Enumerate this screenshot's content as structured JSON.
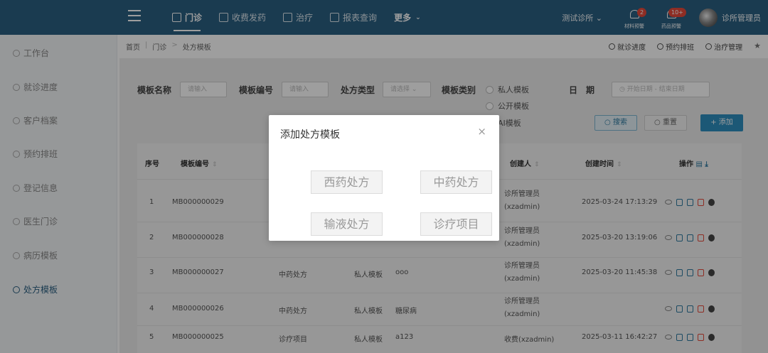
{
  "topbar": {
    "nav": [
      {
        "label": "门诊",
        "icon": "edit-icon",
        "active": true
      },
      {
        "label": "收费发药",
        "icon": "cash-icon",
        "active": false
      },
      {
        "label": "治疗",
        "icon": "treatment-icon",
        "active": false
      },
      {
        "label": "报表查询",
        "icon": "report-icon",
        "active": false
      },
      {
        "label": "更多",
        "icon": "",
        "active": false
      }
    ],
    "clinic": "测试诊所",
    "alerts": [
      {
        "label": "材料预警",
        "badge": "2"
      },
      {
        "label": "药品预警",
        "badge": "10+"
      }
    ],
    "user": "诊所管理员"
  },
  "sidebar": {
    "items": [
      {
        "label": "工作台"
      },
      {
        "label": "就诊进度"
      },
      {
        "label": "客户档案"
      },
      {
        "label": "预约排班"
      },
      {
        "label": "登记信息"
      },
      {
        "label": "医生门诊"
      },
      {
        "label": "病历模板"
      },
      {
        "label": "处方模板"
      }
    ]
  },
  "breadcrumb": [
    "首页",
    "门诊",
    "处方模板"
  ],
  "quick_links": [
    "就诊进度",
    "预约排班",
    "治疗管理"
  ],
  "filters": {
    "name_label": "模板名称",
    "name_placeholder": "请输入",
    "code_label": "模板编号",
    "code_placeholder": "请输入",
    "type_label": "处方类型",
    "type_placeholder": "请选择",
    "category_label": "模板类别",
    "category_options": [
      "私人模板",
      "公开模板",
      "AI模板"
    ],
    "date_label": "日　期",
    "date_placeholder": "开始日期 - 结束日期",
    "search": "搜索",
    "reset": "重置",
    "add": "+ 添加"
  },
  "table": {
    "headers": [
      "序号",
      "模板编号",
      "创建人",
      "创建时间",
      "操作"
    ],
    "rows": [
      {
        "no": "1",
        "code": "MB000000029",
        "type": "",
        "category": "",
        "name": "",
        "creator": "诊所管理员(xzadmin)",
        "time": "2025-03-24 17:13:29"
      },
      {
        "no": "2",
        "code": "MB000000028",
        "type": "",
        "category": "",
        "name": "",
        "creator": "诊所管理员(xzadmin)",
        "time": "2025-03-20 13:19:06"
      },
      {
        "no": "3",
        "code": "MB000000027",
        "type": "中药处方",
        "category": "私人模板",
        "name": "ooo",
        "creator": "诊所管理员(xzadmin)",
        "time": "2025-03-20 11:45:38"
      },
      {
        "no": "4",
        "code": "MB000000026",
        "type": "中药处方",
        "category": "私人模板",
        "name": "糖尿病",
        "creator": "诊所管理员(xzadmin)",
        "time": ""
      },
      {
        "no": "5",
        "code": "MB000000025",
        "type": "诊疗项目",
        "category": "私人模板",
        "name": "a123",
        "creator": "收费(xzadmin)",
        "time": "2025-03-11 16:42:27"
      }
    ]
  },
  "modal": {
    "title": "添加处方模板",
    "close": "×",
    "options": [
      "西药处方",
      "中药处方",
      "输液处方",
      "诊疗项目"
    ]
  }
}
